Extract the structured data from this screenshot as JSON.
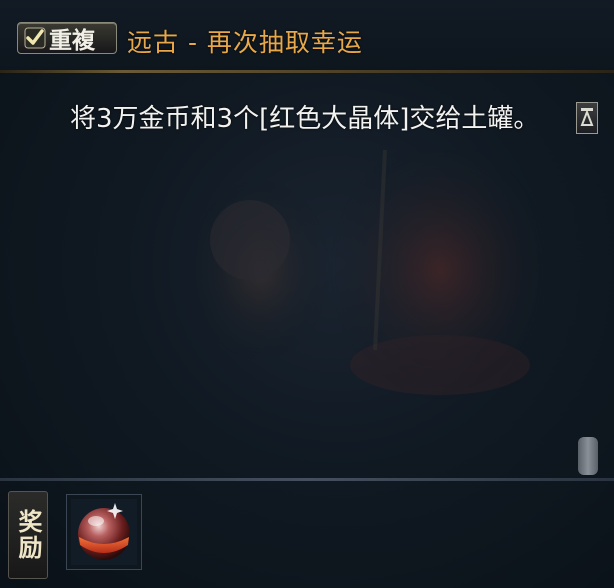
{
  "header": {
    "repeat_label": "重複",
    "title": "远古 - 再次抽取幸运"
  },
  "description": {
    "text": "将3万金币和3个[红色大晶体]交给土罐。"
  },
  "rewards": {
    "label": "奖励",
    "items": [
      {
        "icon": "red-crystal-orb-icon"
      }
    ]
  },
  "icons": {
    "check": "checkmark-icon",
    "scroll_top": "scroll-to-top-icon"
  },
  "colors": {
    "title": "#e8a84a",
    "text": "#f2f2f0",
    "background": "#0b1219"
  }
}
